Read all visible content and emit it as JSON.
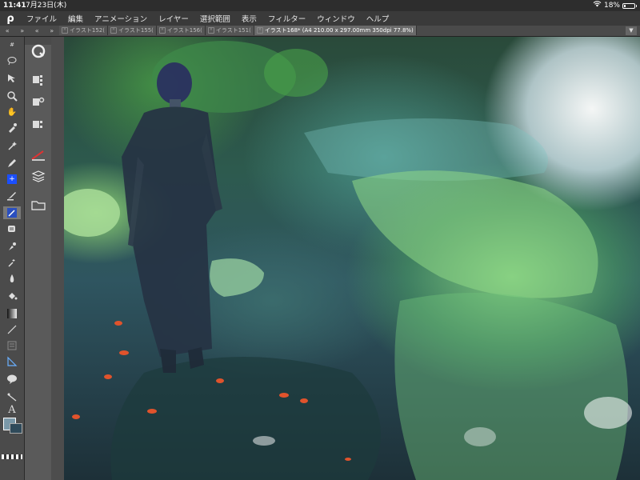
{
  "status_bar": {
    "time": "11:41",
    "date": "7月23日(木)",
    "battery": "18%",
    "battery_level": 0.18
  },
  "menu": {
    "logo": "ρ",
    "items": [
      "ファイル",
      "編集",
      "アニメーション",
      "レイヤー",
      "選択範囲",
      "表示",
      "フィルター",
      "ウィンドウ",
      "ヘルプ"
    ]
  },
  "tabs": [
    {
      "label": "イラスト152(",
      "active": false
    },
    {
      "label": "イラスト155(",
      "active": false
    },
    {
      "label": "イラスト156(",
      "active": false
    },
    {
      "label": "イラスト151(",
      "active": false
    },
    {
      "label": "イラスト168* (A4 210.00 x 297.00mm 350dpi 77.8%)",
      "active": true
    }
  ],
  "toolbar": {
    "subtool_header": "#",
    "text_tool": "A"
  },
  "colors": {
    "main_color": "#7a98a8",
    "sub_color": "#2f4a5a",
    "app_bg": "#3c3c3c",
    "menubar_bg": "#3a3a3a"
  }
}
